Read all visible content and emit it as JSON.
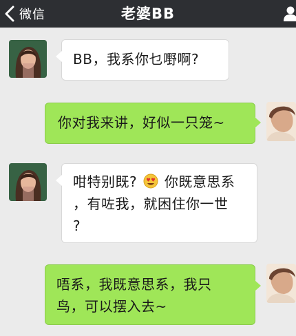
{
  "header": {
    "back_label": "微信",
    "title": "老婆BB"
  },
  "messages": [
    {
      "side": "in",
      "text": "BB，我系你乜嘢啊?"
    },
    {
      "side": "out",
      "text": "你对我来讲，好似一只笼~"
    },
    {
      "side": "in",
      "text_before_emoji": "咁特别既?",
      "emoji": "heart-eyes-emoji",
      "text_after_emoji_line1": "你既意思系",
      "text_line2": "，有咗我，就困住你一世",
      "text_line3": "?"
    },
    {
      "side": "out",
      "text_line1": "唔系，我既意思系，我只",
      "text_line2": "鸟，可以摆入去~"
    }
  ],
  "colors": {
    "header_bg": "#2d2f33",
    "chat_bg": "#ebebeb",
    "outgoing_bubble": "#9fe658",
    "incoming_bubble": "#ffffff"
  }
}
